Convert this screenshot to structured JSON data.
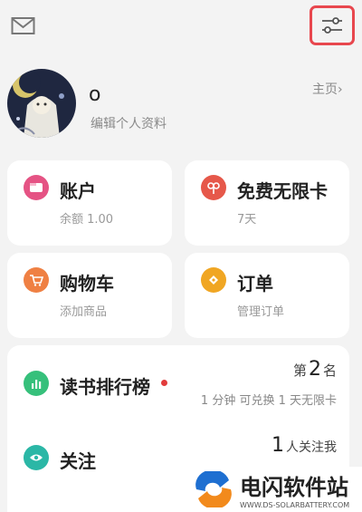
{
  "profile": {
    "username": "o",
    "edit_link": "编辑个人资料",
    "home_link": "主页"
  },
  "cards": {
    "account": {
      "title": "账户",
      "sub": "余额 1.00",
      "color": "#e55384"
    },
    "free_card": {
      "title": "免费无限卡",
      "sub": "7天",
      "color": "#e6584a"
    },
    "cart": {
      "title": "购物车",
      "sub": "添加商品",
      "color": "#ef8043"
    },
    "orders": {
      "title": "订单",
      "sub": "管理订单",
      "color": "#f0a623"
    },
    "ranking": {
      "title": "读书排行榜",
      "rank_prefix": "第",
      "rank_num": "2",
      "rank_suffix": "名",
      "detail": "1 分钟 可兑换 1 天无限卡",
      "color": "#36c07b"
    },
    "follow": {
      "title": "关注",
      "count": "1",
      "count_suffix": "人关注我",
      "color": "#2bb7a6"
    }
  },
  "watermark": {
    "title": "电闪软件站",
    "sub": "WWW.DS-SOLARBATTERY.COM"
  }
}
